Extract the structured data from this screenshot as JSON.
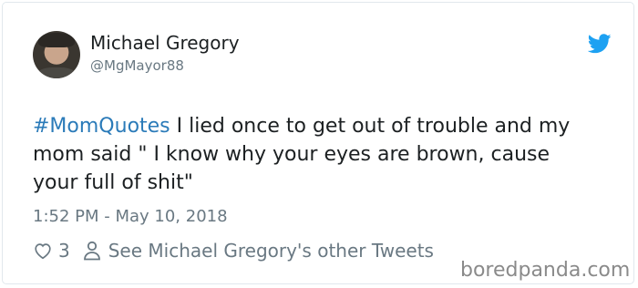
{
  "tweet": {
    "author_name": "Michael Gregory",
    "author_handle": "@MgMayor88",
    "hashtag": "#MomQuotes",
    "body": " I lied once to get out of trouble and my mom said \" I know why your eyes are brown, cause your full of shit\"",
    "timestamp": "1:52 PM - May 10, 2018",
    "like_count": "3",
    "other_tweets_link": "See Michael Gregory's other Tweets"
  },
  "watermark": "boredpanda.com",
  "colors": {
    "text": "#1c2022",
    "secondary": "#697882",
    "hashtag": "#2b7bb9",
    "twitter_blue": "#1da1f2",
    "border": "#e1e8ed"
  },
  "icons": {
    "brand": "twitter-bird-icon",
    "like": "heart-icon",
    "profile": "person-icon"
  }
}
